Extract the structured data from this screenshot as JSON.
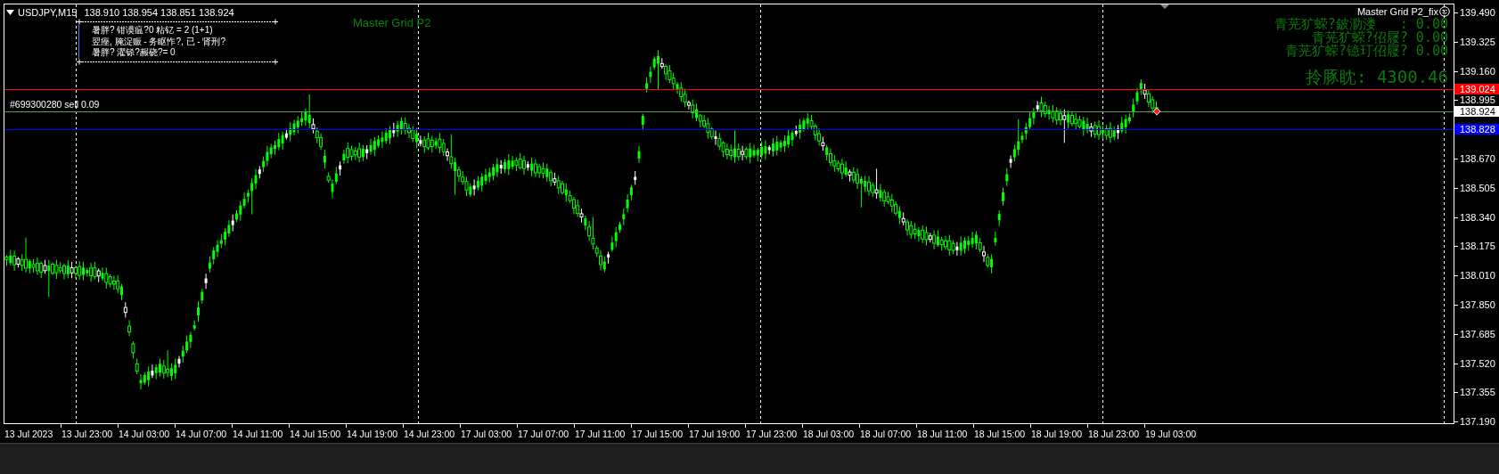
{
  "header": {
    "symbol": "USDJPY,M15",
    "ohlc": "138.910 138.954 138.851 138.924"
  },
  "info_panel": {
    "lines": [
      "暑胖? 钳谟瘟?0 粘钇 = 2 (1+1)",
      "翌痤, 腌浞赈 - 务眍怍?, 已 - 肾刑?",
      "暑胖? 濯铩?赧硗?= 0"
    ]
  },
  "indicator_label": "Master Grid P2",
  "ea_name": "Master Grid P2_fix",
  "stats": [
    "青茪犷蝾?鈹泐溇   : 0.00",
    "青茪犷蝾?佋屦? 0.00",
    "青茪犷蝾?镱玎佋屦? 0.00"
  ],
  "balance": "拎豚眈: 4300.46",
  "order_label": "#699300280 sell 0.09",
  "price_levels": [
    {
      "label": "139.024",
      "color": "#ff0000"
    },
    {
      "label": "138.924",
      "color": "#ffffff"
    },
    {
      "label": "138.828",
      "color": "#0000ff"
    }
  ],
  "price_axis": {
    "ticks": [
      "139.490",
      "139.325",
      "139.160",
      "138.995",
      "138.670",
      "138.505",
      "138.340",
      "138.175",
      "138.010",
      "137.850",
      "137.685",
      "137.520",
      "137.355",
      "137.190"
    ]
  },
  "time_axis": {
    "ticks": [
      "13 Jul 2023",
      "13 Jul 23:00",
      "14 Jul 03:00",
      "14 Jul 07:00",
      "14 Jul 11:00",
      "14 Jul 15:00",
      "14 Jul 19:00",
      "14 Jul 23:00",
      "17 Jul 03:00",
      "17 Jul 07:00",
      "17 Jul 11:00",
      "17 Jul 15:00",
      "17 Jul 19:00",
      "17 Jul 23:00",
      "18 Jul 03:00",
      "18 Jul 07:00",
      "18 Jul 11:00",
      "18 Jul 15:00",
      "18 Jul 19:00",
      "18 Jul 23:00",
      "19 Jul 03:00"
    ]
  }
}
